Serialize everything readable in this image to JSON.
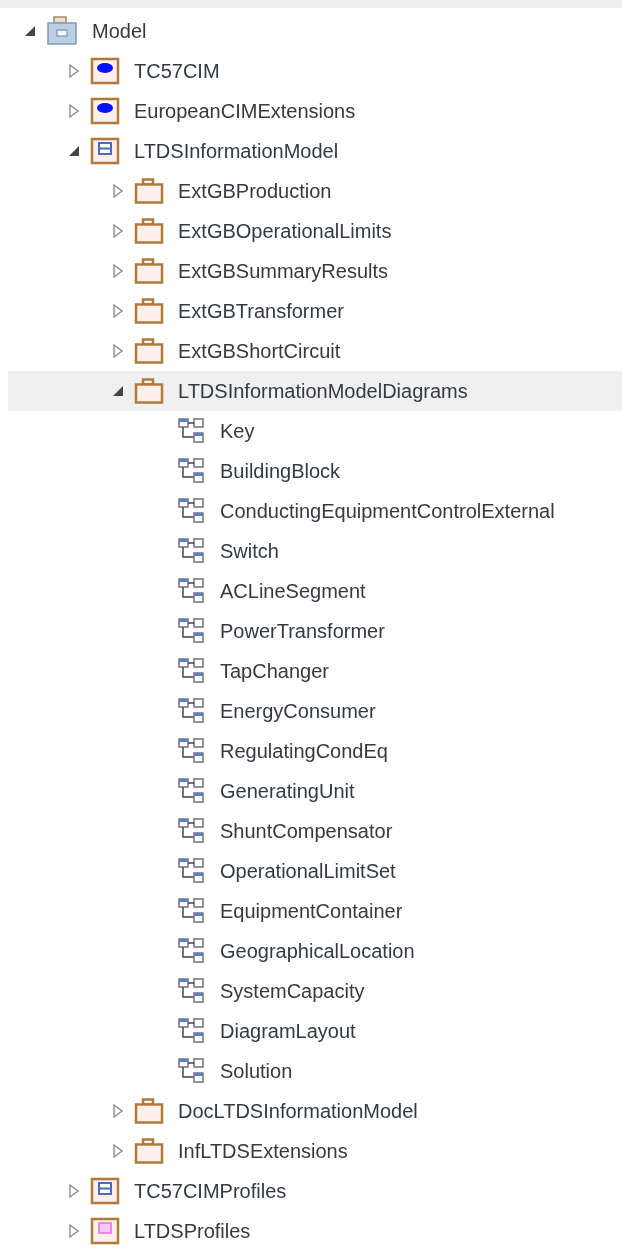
{
  "tree": [
    {
      "label": "Model",
      "kind": "model",
      "expanded": true,
      "selected": false,
      "children": [
        {
          "label": "TC57CIM",
          "kind": "package-ellipse",
          "expanded": false,
          "selected": false
        },
        {
          "label": "EuropeanCIMExtensions",
          "kind": "package-ellipse",
          "expanded": false,
          "selected": false
        },
        {
          "label": "LTDSInformationModel",
          "kind": "package-class",
          "expanded": true,
          "selected": false,
          "children": [
            {
              "label": "ExtGBProduction",
              "kind": "folder",
              "expanded": false,
              "selected": false
            },
            {
              "label": "ExtGBOperationalLimits",
              "kind": "folder",
              "expanded": false,
              "selected": false
            },
            {
              "label": "ExtGBSummaryResults",
              "kind": "folder",
              "expanded": false,
              "selected": false
            },
            {
              "label": "ExtGBTransformer",
              "kind": "folder",
              "expanded": false,
              "selected": false
            },
            {
              "label": "ExtGBShortCircuit",
              "kind": "folder",
              "expanded": false,
              "selected": false
            },
            {
              "label": "LTDSInformationModelDiagrams",
              "kind": "folder",
              "expanded": true,
              "selected": true,
              "children": [
                {
                  "label": "Key",
                  "kind": "diagram",
                  "selected": false
                },
                {
                  "label": "BuildingBlock",
                  "kind": "diagram",
                  "selected": false
                },
                {
                  "label": "ConductingEquipmentControlExternal",
                  "kind": "diagram",
                  "selected": false
                },
                {
                  "label": "Switch",
                  "kind": "diagram",
                  "selected": false
                },
                {
                  "label": "ACLineSegment",
                  "kind": "diagram",
                  "selected": false
                },
                {
                  "label": "PowerTransformer",
                  "kind": "diagram",
                  "selected": false
                },
                {
                  "label": "TapChanger",
                  "kind": "diagram",
                  "selected": false
                },
                {
                  "label": "EnergyConsumer",
                  "kind": "diagram",
                  "selected": false
                },
                {
                  "label": "RegulatingCondEq",
                  "kind": "diagram",
                  "selected": false
                },
                {
                  "label": "GeneratingUnit",
                  "kind": "diagram",
                  "selected": false
                },
                {
                  "label": "ShuntCompensator",
                  "kind": "diagram",
                  "selected": false
                },
                {
                  "label": "OperationalLimitSet",
                  "kind": "diagram",
                  "selected": false
                },
                {
                  "label": "EquipmentContainer",
                  "kind": "diagram",
                  "selected": false
                },
                {
                  "label": "GeographicalLocation",
                  "kind": "diagram",
                  "selected": false
                },
                {
                  "label": "SystemCapacity",
                  "kind": "diagram",
                  "selected": false
                },
                {
                  "label": "DiagramLayout",
                  "kind": "diagram",
                  "selected": false
                },
                {
                  "label": "Solution",
                  "kind": "diagram",
                  "selected": false
                }
              ]
            },
            {
              "label": "DocLTDSInformationModel",
              "kind": "folder",
              "expanded": false,
              "selected": false
            },
            {
              "label": "InfLTDSExtensions",
              "kind": "folder",
              "expanded": false,
              "selected": false
            }
          ]
        },
        {
          "label": "TC57CIMProfiles",
          "kind": "package-class",
          "expanded": false,
          "selected": false
        },
        {
          "label": "LTDSProfiles",
          "kind": "package-profile",
          "expanded": false,
          "selected": false
        }
      ]
    }
  ]
}
